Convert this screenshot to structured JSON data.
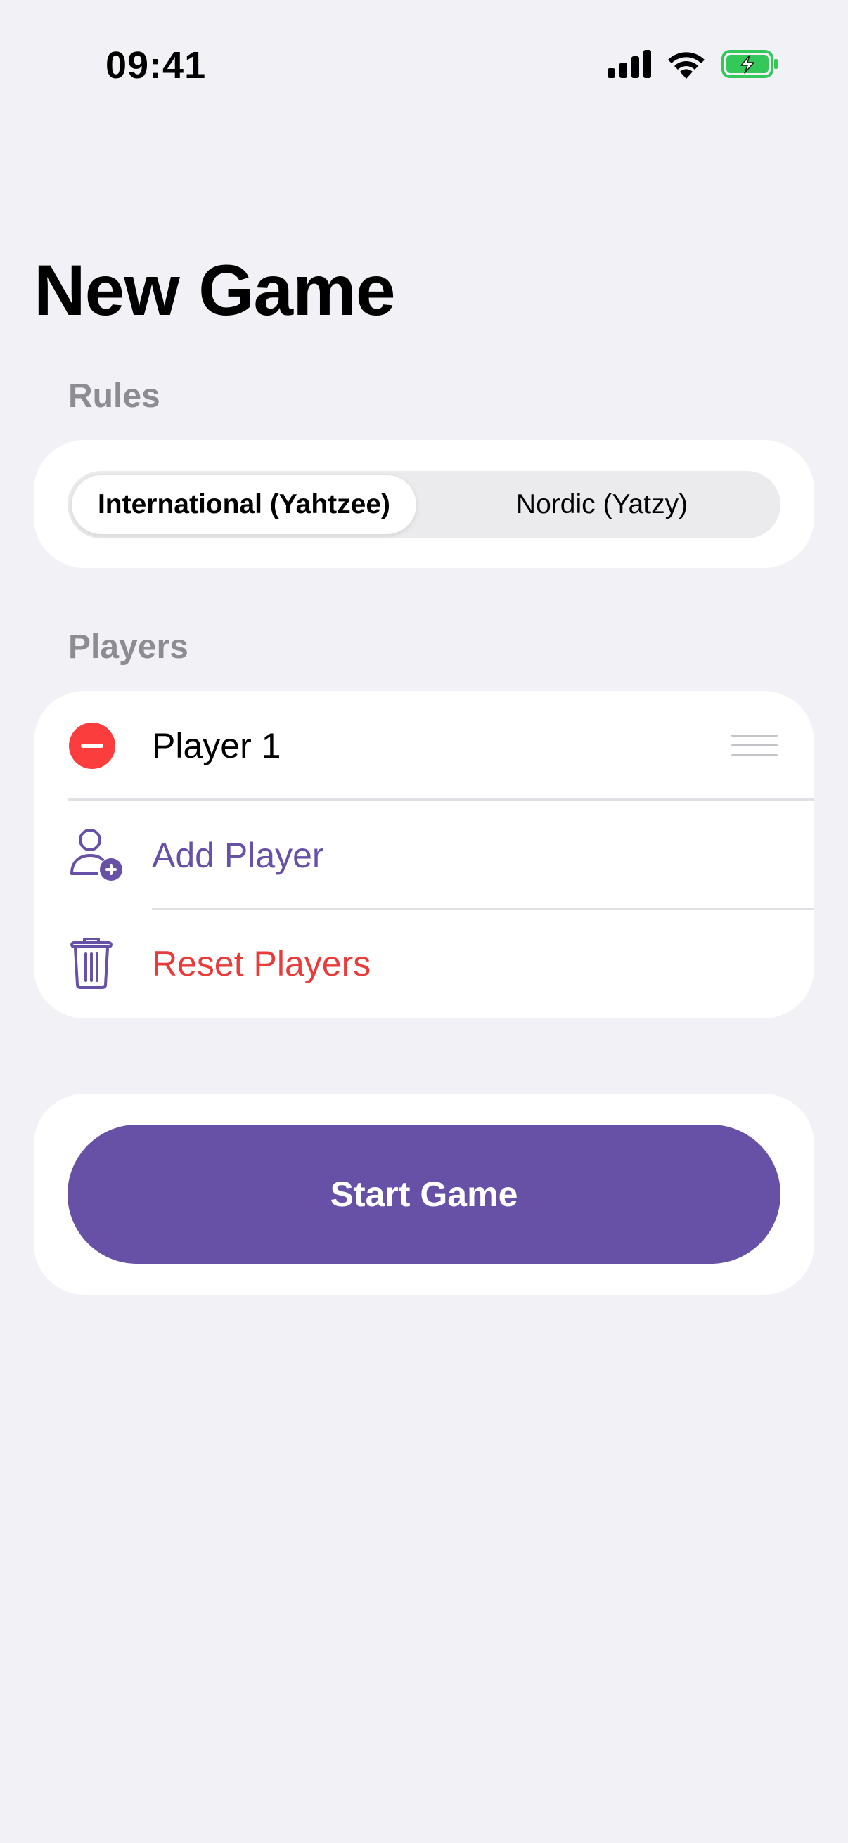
{
  "status_bar": {
    "time": "09:41"
  },
  "title": "New Game",
  "rules": {
    "header": "Rules",
    "options": [
      "International (Yahtzee)",
      "Nordic (Yatzy)"
    ],
    "selected": "International (Yahtzee)"
  },
  "players": {
    "header": "Players",
    "list": [
      {
        "name": "Player 1"
      }
    ],
    "add_label": "Add Player",
    "reset_label": "Reset Players"
  },
  "start_button_label": "Start Game",
  "colors": {
    "accent": "#6751a6",
    "destructive": "#e53935",
    "battery": "#34c759",
    "background": "#f2f1f6"
  }
}
